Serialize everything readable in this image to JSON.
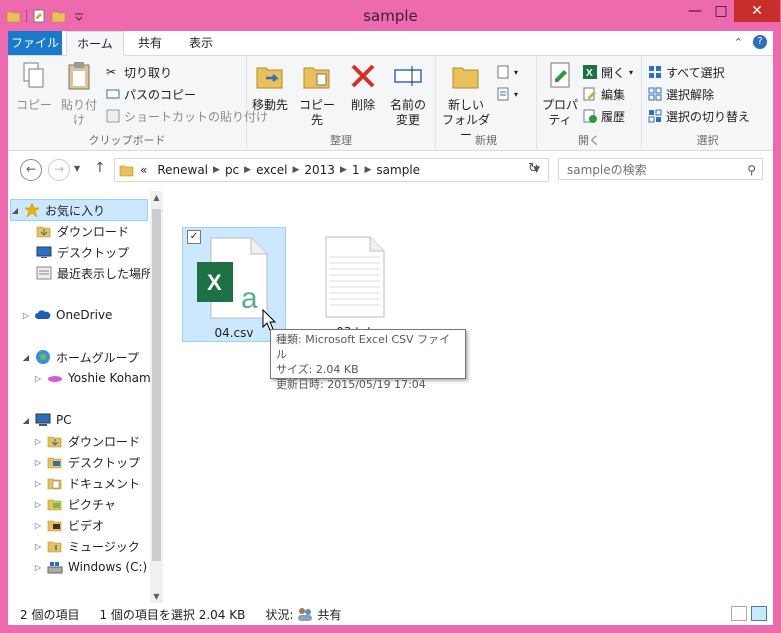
{
  "window": {
    "title": "sample"
  },
  "tabs": {
    "file": "ファイル",
    "home": "ホーム",
    "share": "共有",
    "view": "表示"
  },
  "ribbon": {
    "clipboard": {
      "label": "クリップボード",
      "copy": "コピー",
      "paste": "貼り付け",
      "cut": "切り取り",
      "copy_path": "パスのコピー",
      "paste_shortcut": "ショートカットの貼り付け"
    },
    "organize": {
      "label": "整理",
      "move_to": "移動先",
      "copy_to": "コピー先",
      "delete": "削除",
      "rename_1": "名前の",
      "rename_2": "変更"
    },
    "new": {
      "label": "新規",
      "new_folder_1": "新しい",
      "new_folder_2": "フォルダー"
    },
    "open": {
      "label": "開く",
      "properties": "プロパティ",
      "open": "開く",
      "edit": "編集",
      "history": "履歴"
    },
    "select": {
      "label": "選択",
      "select_all": "すべて選択",
      "select_none": "選択解除",
      "invert": "選択の切り替え"
    }
  },
  "address": {
    "prefix": "«",
    "crumbs": [
      "Renewal",
      "pc",
      "excel",
      "2013",
      "1",
      "sample"
    ]
  },
  "search": {
    "placeholder": "sampleの検索"
  },
  "nav": {
    "favorites": "お気に入り",
    "downloads": "ダウンロード",
    "desktop": "デスクトップ",
    "recent": "最近表示した場所",
    "onedrive": "OneDrive",
    "homegroup": "ホームグループ",
    "user": "Yoshie Kohama",
    "pc": "PC",
    "pc_downloads": "ダウンロード",
    "pc_desktop": "デスクトップ",
    "documents": "ドキュメント",
    "pictures": "ピクチャ",
    "videos": "ビデオ",
    "music": "ミュージック",
    "windows_c": "Windows (C:)"
  },
  "files": [
    {
      "name": "04.csv"
    },
    {
      "name": "03.txt"
    }
  ],
  "tooltip": {
    "type": "種類: Microsoft Excel CSV ファイル",
    "size": "サイズ: 2.04 KB",
    "date": "更新日時: 2015/05/19 17:04"
  },
  "status": {
    "count": "2 個の項目",
    "selected": "1 個の項目を選択  2.04 KB",
    "state_label": "状況:",
    "state_value": "共有"
  },
  "colors": {
    "accent": "#1979ca",
    "window_frame": "#ee6aae",
    "selection": "#cce8ff",
    "close": "#c7302a",
    "excel": "#1e7145"
  }
}
